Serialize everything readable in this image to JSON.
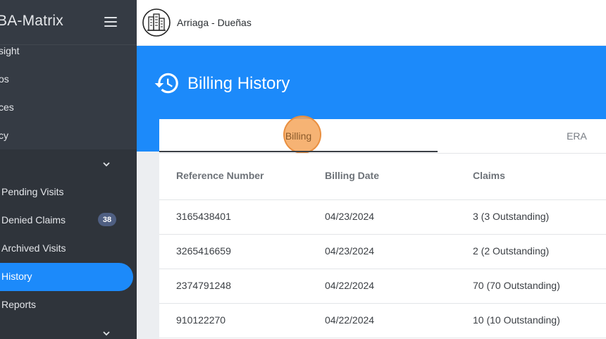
{
  "app": {
    "brand": "BA-Matrix",
    "org_name": "Arriaga - Dueñas"
  },
  "sidebar": {
    "top_items": [
      {
        "label": "sight"
      },
      {
        "label": "os"
      },
      {
        "label": "ces"
      },
      {
        "label": "cy"
      }
    ],
    "items": [
      {
        "label": "Pending Visits"
      },
      {
        "label": "Denied Claims",
        "badge": "38"
      },
      {
        "label": "Archived Visits"
      },
      {
        "label": "History",
        "active": true
      },
      {
        "label": "Reports"
      }
    ]
  },
  "page": {
    "title": "Billing History",
    "icon": "history-icon"
  },
  "tabs": [
    {
      "label": "Billing",
      "active": true
    },
    {
      "label": "ERA",
      "active": false
    }
  ],
  "table": {
    "columns": [
      "Reference Number",
      "Billing Date",
      "Claims"
    ],
    "rows": [
      [
        "3165438401",
        "04/23/2024",
        "3 (3 Outstanding)"
      ],
      [
        "3265416659",
        "04/23/2024",
        "2 (2 Outstanding)"
      ],
      [
        "2374791248",
        "04/22/2024",
        "70 (70 Outstanding)"
      ],
      [
        "910122270",
        "04/22/2024",
        "10 (10 Outstanding)"
      ]
    ]
  },
  "colors": {
    "primary": "#1c8afa",
    "sidebar_bg": "#2f343b",
    "sidebar_top_bg": "#353b44",
    "badge": "#4f5f82",
    "ripple": "#f4a65c"
  }
}
